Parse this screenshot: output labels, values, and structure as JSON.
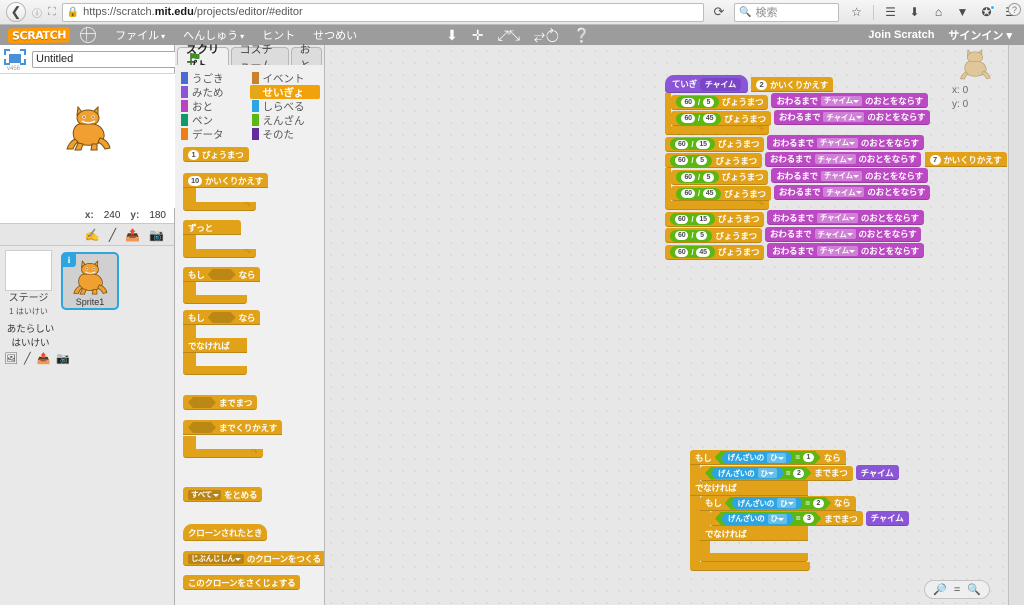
{
  "browser": {
    "back_icon": "back-arrow",
    "url_prefix": "https://scratch.",
    "url_domain": "mit.edu",
    "url_suffix": "/projects/editor/#editor",
    "reload_icon": "reload",
    "search_placeholder": "検索",
    "icons": [
      "bookmark-star",
      "library",
      "download",
      "home",
      "pocket",
      "sync",
      "menu"
    ]
  },
  "menubar": {
    "logo": "SCRATCH",
    "items": [
      {
        "label": "ファイル",
        "caret": "▾"
      },
      {
        "label": "へんしゅう",
        "caret": "▾"
      },
      {
        "label": "ヒント",
        "caret": ""
      },
      {
        "label": "せつめい",
        "caret": ""
      }
    ],
    "tools": [
      "duplicate-icon",
      "cut-icon",
      "grow-icon",
      "shrink-icon",
      "help-icon"
    ],
    "join": "Join Scratch",
    "signin": "サインイン ▾"
  },
  "stage": {
    "fullscreen_label": "v456",
    "project_title": "Untitled",
    "project_placeholder": "Untitled",
    "green_flag": "green-flag",
    "stop": "stop-button",
    "x_label": "x:",
    "x_value": "240",
    "y_label": "y:",
    "y_value": "180"
  },
  "sprite_panel": {
    "toolbar_icons": [
      "new-sprite-paint",
      "new-sprite-brush",
      "new-sprite-upload",
      "new-sprite-camera"
    ],
    "stage_thumb_label": "ステージ",
    "stage_thumb_sub": "1 はいけい",
    "sprites": [
      {
        "name": "Sprite1",
        "info_badge": "i",
        "selected": true
      }
    ],
    "new_sprite_label": "あたらしいはいけい",
    "new_sprite_icons": [
      "image-icon",
      "brush-icon",
      "upload-icon",
      "camera-icon"
    ]
  },
  "palette": {
    "tabs": [
      {
        "label": "スクリプト",
        "active": true
      },
      {
        "label": "コスチューム",
        "active": false
      },
      {
        "label": "おと",
        "active": false
      }
    ],
    "categories_left": [
      {
        "label": "うごき",
        "color": "#4a6cd4"
      },
      {
        "label": "みため",
        "color": "#8a55d7"
      },
      {
        "label": "おと",
        "color": "#bb42c3"
      },
      {
        "label": "ペン",
        "color": "#0e9a6c"
      },
      {
        "label": "データ",
        "color": "#ee7d16"
      }
    ],
    "categories_right": [
      {
        "label": "イベント",
        "color": "#c88330",
        "selected": false
      },
      {
        "label": "せいぎょ",
        "color": "#e1a91a",
        "selected": true
      },
      {
        "label": "しらべる",
        "color": "#2ca5e2",
        "selected": false
      },
      {
        "label": "えんざん",
        "color": "#5cb712",
        "selected": false
      },
      {
        "label": "そのた",
        "color": "#632d99",
        "selected": false
      }
    ],
    "blocks": [
      {
        "type": "stack",
        "parts": [
          {
            "k": "num",
            "v": "1"
          },
          {
            "k": "t",
            "v": "びょうまつ"
          }
        ]
      },
      {
        "type": "c",
        "parts": [
          {
            "k": "num",
            "v": "10"
          },
          {
            "k": "t",
            "v": "かいくりかえす"
          }
        ]
      },
      {
        "type": "c",
        "parts": [
          {
            "k": "t",
            "v": "ずっと"
          }
        ]
      },
      {
        "type": "c",
        "parts": [
          {
            "k": "t",
            "v": "もし"
          },
          {
            "k": "bool",
            "v": ""
          },
          {
            "k": "t",
            "v": "なら"
          }
        ]
      },
      {
        "type": "c-else",
        "parts": [
          {
            "k": "t",
            "v": "もし"
          },
          {
            "k": "bool",
            "v": ""
          },
          {
            "k": "t",
            "v": "なら"
          }
        ],
        "else_label": "でなければ"
      },
      {
        "type": "stack",
        "parts": [
          {
            "k": "bool",
            "v": ""
          },
          {
            "k": "t",
            "v": "までまつ"
          }
        ]
      },
      {
        "type": "c",
        "parts": [
          {
            "k": "bool",
            "v": ""
          },
          {
            "k": "t",
            "v": "までくりかえす"
          }
        ]
      },
      {
        "type": "stack",
        "parts": [
          {
            "k": "dd",
            "v": "すべて"
          },
          {
            "k": "t",
            "v": "をとめる"
          }
        ]
      },
      {
        "type": "hat",
        "parts": [
          {
            "k": "t",
            "v": "クローンされたとき"
          }
        ]
      },
      {
        "type": "stack",
        "parts": [
          {
            "k": "dd",
            "v": "じぶんじしん"
          },
          {
            "k": "t",
            "v": "のクローンをつくる"
          }
        ]
      },
      {
        "type": "stack",
        "parts": [
          {
            "k": "t",
            "v": "このクローンをさくじょする"
          }
        ]
      }
    ]
  },
  "scripts": {
    "main": {
      "hat": {
        "label": "ていぎ",
        "proc": "チャイム"
      },
      "rows": [
        {
          "id": "r1",
          "indent": 0,
          "kind": "repeat-open",
          "count": "2",
          "label": "かいくりかえす"
        },
        {
          "id": "r2",
          "indent": 1,
          "kind": "wait-div",
          "a": "60",
          "op": "/",
          "b": "5",
          "label": "びょうまつ"
        },
        {
          "id": "r3",
          "indent": 1,
          "kind": "play-until",
          "pre": "おわるまで",
          "sound": "チャイム",
          "post": "のおとをならす"
        },
        {
          "id": "r4",
          "indent": 1,
          "kind": "wait-div",
          "a": "60",
          "op": "/",
          "b": "45",
          "label": "びょうまつ"
        },
        {
          "id": "r5",
          "indent": 1,
          "kind": "play-until",
          "pre": "おわるまで",
          "sound": "チャイム",
          "post": "のおとをならす"
        },
        {
          "id": "r6",
          "indent": 0,
          "kind": "repeat-close"
        },
        {
          "id": "r7",
          "indent": 0,
          "kind": "wait-div",
          "a": "60",
          "op": "/",
          "b": "15",
          "label": "びょうまつ"
        },
        {
          "id": "r8",
          "indent": 0,
          "kind": "play-until",
          "pre": "おわるまで",
          "sound": "チャイム",
          "post": "のおとをならす"
        },
        {
          "id": "r9",
          "indent": 0,
          "kind": "wait-div",
          "a": "60",
          "op": "/",
          "b": "5",
          "label": "びょうまつ"
        },
        {
          "id": "r10",
          "indent": 0,
          "kind": "play-until",
          "pre": "おわるまで",
          "sound": "チャイム",
          "post": "のおとをならす"
        },
        {
          "id": "r11",
          "indent": 0,
          "kind": "repeat-open",
          "count": "7",
          "label": "かいくりかえす"
        },
        {
          "id": "r12",
          "indent": 1,
          "kind": "wait-div",
          "a": "60",
          "op": "/",
          "b": "5",
          "label": "びょうまつ"
        },
        {
          "id": "r13",
          "indent": 1,
          "kind": "play-until",
          "pre": "おわるまで",
          "sound": "チャイム",
          "post": "のおとをならす"
        },
        {
          "id": "r14",
          "indent": 1,
          "kind": "wait-div",
          "a": "60",
          "op": "/",
          "b": "45",
          "label": "びょうまつ"
        },
        {
          "id": "r15",
          "indent": 1,
          "kind": "play-until",
          "pre": "おわるまで",
          "sound": "チャイム",
          "post": "のおとをならす"
        },
        {
          "id": "r16",
          "indent": 0,
          "kind": "repeat-close"
        },
        {
          "id": "r17",
          "indent": 0,
          "kind": "wait-div",
          "a": "60",
          "op": "/",
          "b": "15",
          "label": "びょうまつ"
        },
        {
          "id": "r18",
          "indent": 0,
          "kind": "play-until",
          "pre": "おわるまで",
          "sound": "チャイム",
          "post": "のおとをならす"
        },
        {
          "id": "r19",
          "indent": 0,
          "kind": "wait-div",
          "a": "60",
          "op": "/",
          "b": "5",
          "label": "びょうまつ"
        },
        {
          "id": "r20",
          "indent": 0,
          "kind": "play-until",
          "pre": "おわるまで",
          "sound": "チャイム",
          "post": "のおとをならす"
        },
        {
          "id": "r21",
          "indent": 0,
          "kind": "wait-div",
          "a": "60",
          "op": "/",
          "b": "45",
          "label": "びょうまつ"
        },
        {
          "id": "r22",
          "indent": 0,
          "kind": "play-until",
          "pre": "おわるまで",
          "sound": "チャイム",
          "post": "のおとをならす"
        }
      ]
    },
    "second": {
      "if1_pre": "もし",
      "if1_sensing": "げんざいの",
      "if1_dropdown": "ひ",
      "if1_eq": "=",
      "if1_value": "1",
      "if1_post": "なら",
      "wait1_sensing": "げんざいの",
      "wait1_dropdown": "ひ",
      "wait1_eq": "=",
      "wait1_value": "2",
      "wait1_post": "までまつ",
      "call1": "チャイム",
      "else1": "でなければ",
      "if2_pre": "もし",
      "if2_sensing": "げんざいの",
      "if2_dropdown": "ひ",
      "if2_eq": "=",
      "if2_value": "2",
      "if2_post": "なら",
      "wait2_sensing": "げんざいの",
      "wait2_dropdown": "ひ",
      "wait2_eq": "=",
      "wait2_value": "3",
      "wait2_post": "までまつ",
      "call2": "チャイム",
      "else2": "でなければ"
    }
  },
  "hud": {
    "x_label": "x:",
    "x_value": "0",
    "y_label": "y:",
    "y_value": "0",
    "help": "?"
  },
  "zoom_controls": {
    "zoom_out": "zoom-out",
    "zoom_reset": "=",
    "zoom_in": "zoom-in"
  },
  "colors": {
    "control": "#e1a21a",
    "sound": "#bc49c4",
    "sensing": "#2ca5e2",
    "operators": "#5cb712",
    "more_blocks": "#8a55d7",
    "accent": "#f1a10a",
    "selection": "#2fa5e0"
  }
}
